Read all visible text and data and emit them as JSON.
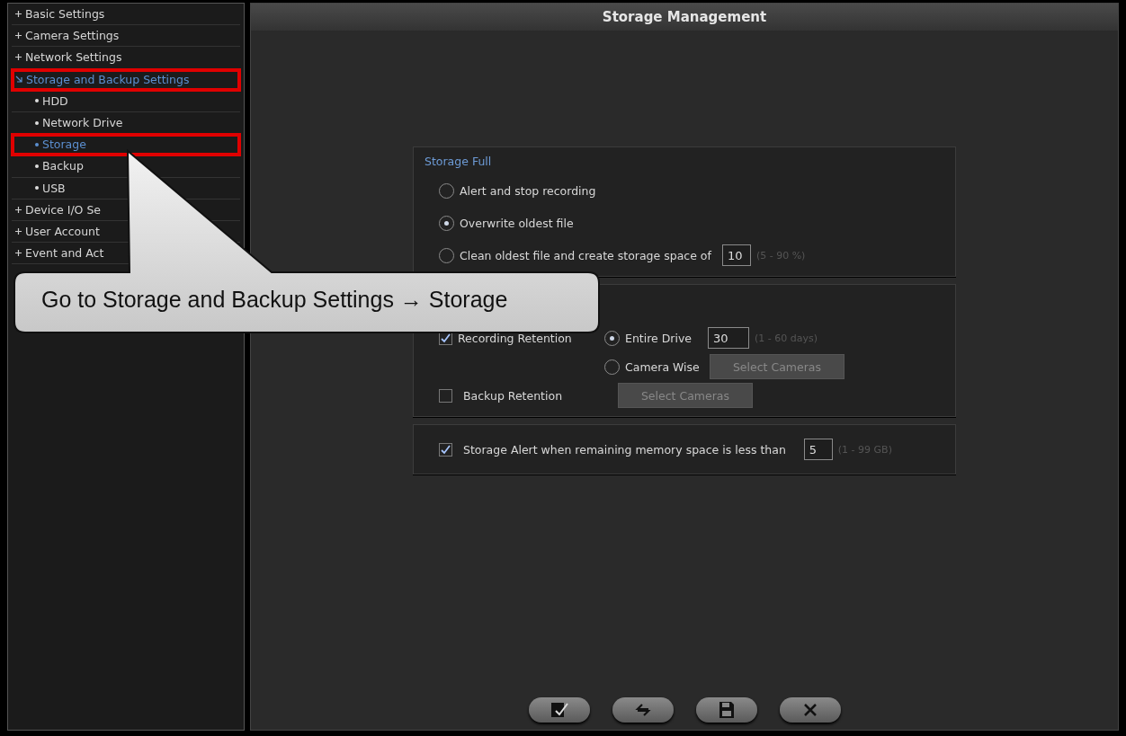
{
  "sidebar": {
    "items": [
      {
        "label": "Basic Settings",
        "expanded": false,
        "selected": false,
        "highlighted": false
      },
      {
        "label": "Camera Settings",
        "expanded": false,
        "selected": false,
        "highlighted": false
      },
      {
        "label": "Network Settings",
        "expanded": false,
        "selected": false,
        "highlighted": false
      },
      {
        "label": "Storage and Backup Settings",
        "expanded": true,
        "selected": true,
        "highlighted": true,
        "children": [
          {
            "label": "HDD",
            "selected": false,
            "highlighted": false
          },
          {
            "label": "Network Drive",
            "selected": false,
            "highlighted": false
          },
          {
            "label": "Storage",
            "selected": true,
            "highlighted": true
          },
          {
            "label": "Backup",
            "selected": false,
            "highlighted": false
          },
          {
            "label": "USB",
            "selected": false,
            "highlighted": false
          }
        ]
      },
      {
        "label": "Device I/O Se",
        "expanded": false,
        "selected": false,
        "highlighted": false
      },
      {
        "label": "User Account",
        "expanded": false,
        "selected": false,
        "highlighted": false
      },
      {
        "label": "Event and Act",
        "expanded": false,
        "selected": false,
        "highlighted": false
      }
    ]
  },
  "header": {
    "title": "Storage Management"
  },
  "storage_full": {
    "title": "Storage Full",
    "options": [
      {
        "label": "Alert and stop recording",
        "selected": false
      },
      {
        "label": "Overwrite oldest file",
        "selected": true
      },
      {
        "label": "Clean oldest file and create storage space of",
        "selected": false,
        "value": "10",
        "range": "(5 - 90 %)"
      }
    ]
  },
  "retention": {
    "recording": {
      "label": "Recording Retention",
      "checked": true,
      "options": [
        {
          "label": "Entire Drive",
          "selected": true,
          "value": "30",
          "range": "(1 - 60 days)"
        },
        {
          "label": "Camera Wise",
          "selected": false,
          "button": "Select Cameras"
        }
      ]
    },
    "backup": {
      "label": "Backup Retention",
      "checked": false,
      "button": "Select Cameras"
    }
  },
  "storage_alert": {
    "label": "Storage Alert when remaining memory space is less than",
    "checked": true,
    "value": "5",
    "range": "(1 - 99 GB)"
  },
  "footer_buttons": [
    {
      "kind": "apply"
    },
    {
      "kind": "refresh"
    },
    {
      "kind": "save"
    },
    {
      "kind": "close"
    }
  ],
  "callout": {
    "text": "Go to Storage and Backup Settings → Storage"
  }
}
